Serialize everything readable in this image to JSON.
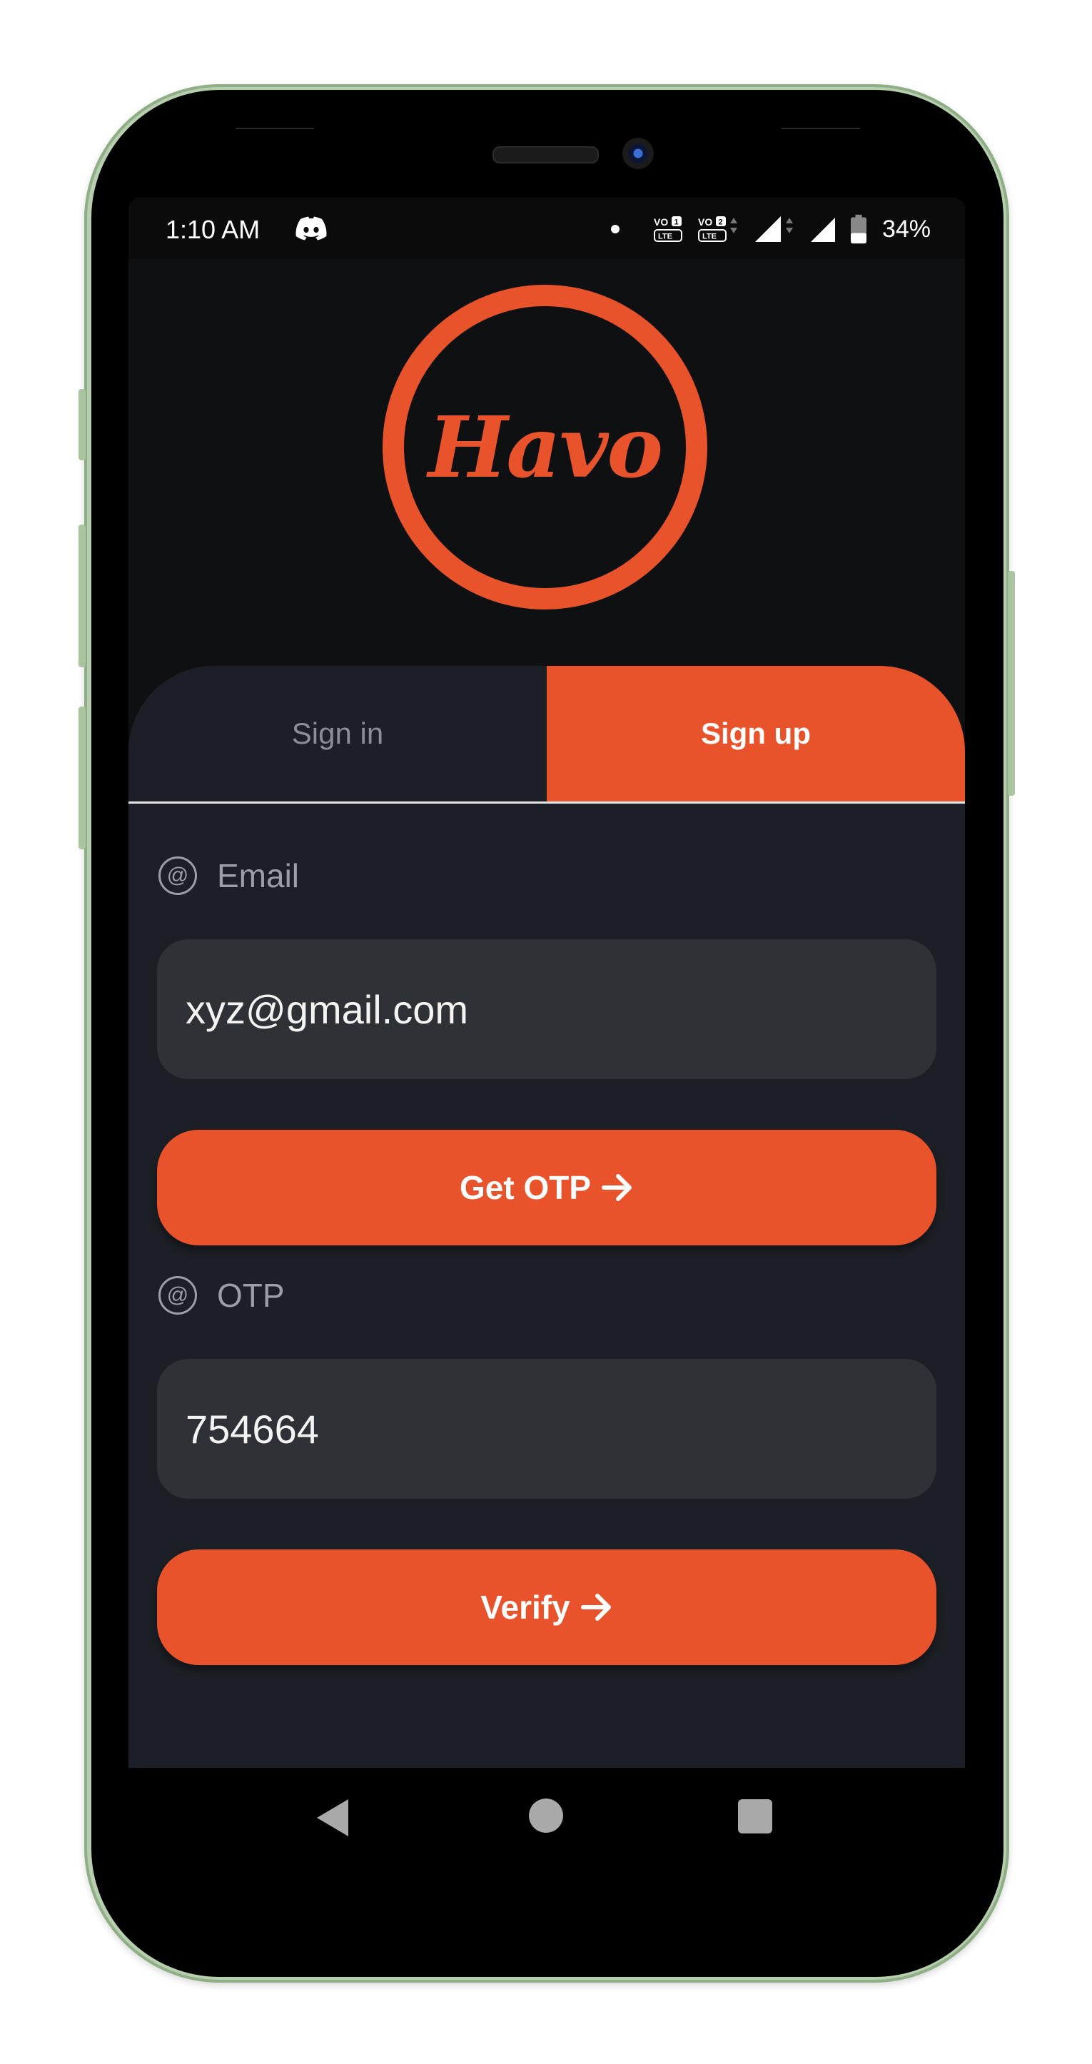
{
  "status_bar": {
    "time": "1:10 AM",
    "battery": "34%",
    "icons": [
      "discord-icon",
      "notification-dot-icon",
      "volte-1-icon",
      "volte-2-icon",
      "signal-1-icon",
      "signal-2-icon",
      "battery-icon"
    ]
  },
  "logo": {
    "text": "Havo",
    "color": "#e8532b"
  },
  "tabs": [
    {
      "label": "Sign in",
      "active": false
    },
    {
      "label": "Sign up",
      "active": true
    }
  ],
  "form": {
    "email": {
      "label": "Email",
      "value": "xyz@gmail.com",
      "icon": "at-icon"
    },
    "get_otp_button": "Get OTP",
    "otp": {
      "label": "OTP",
      "value": "754664",
      "icon": "at-icon"
    },
    "verify_button": "Verify"
  },
  "nav_bar": {
    "icons": [
      "back-icon",
      "home-icon",
      "recents-icon"
    ]
  },
  "colors": {
    "accent": "#e8532b",
    "background": "#0e1012",
    "panel": "#1c2026",
    "input": "#2e3236",
    "phone_frame": "#b7cfae"
  }
}
